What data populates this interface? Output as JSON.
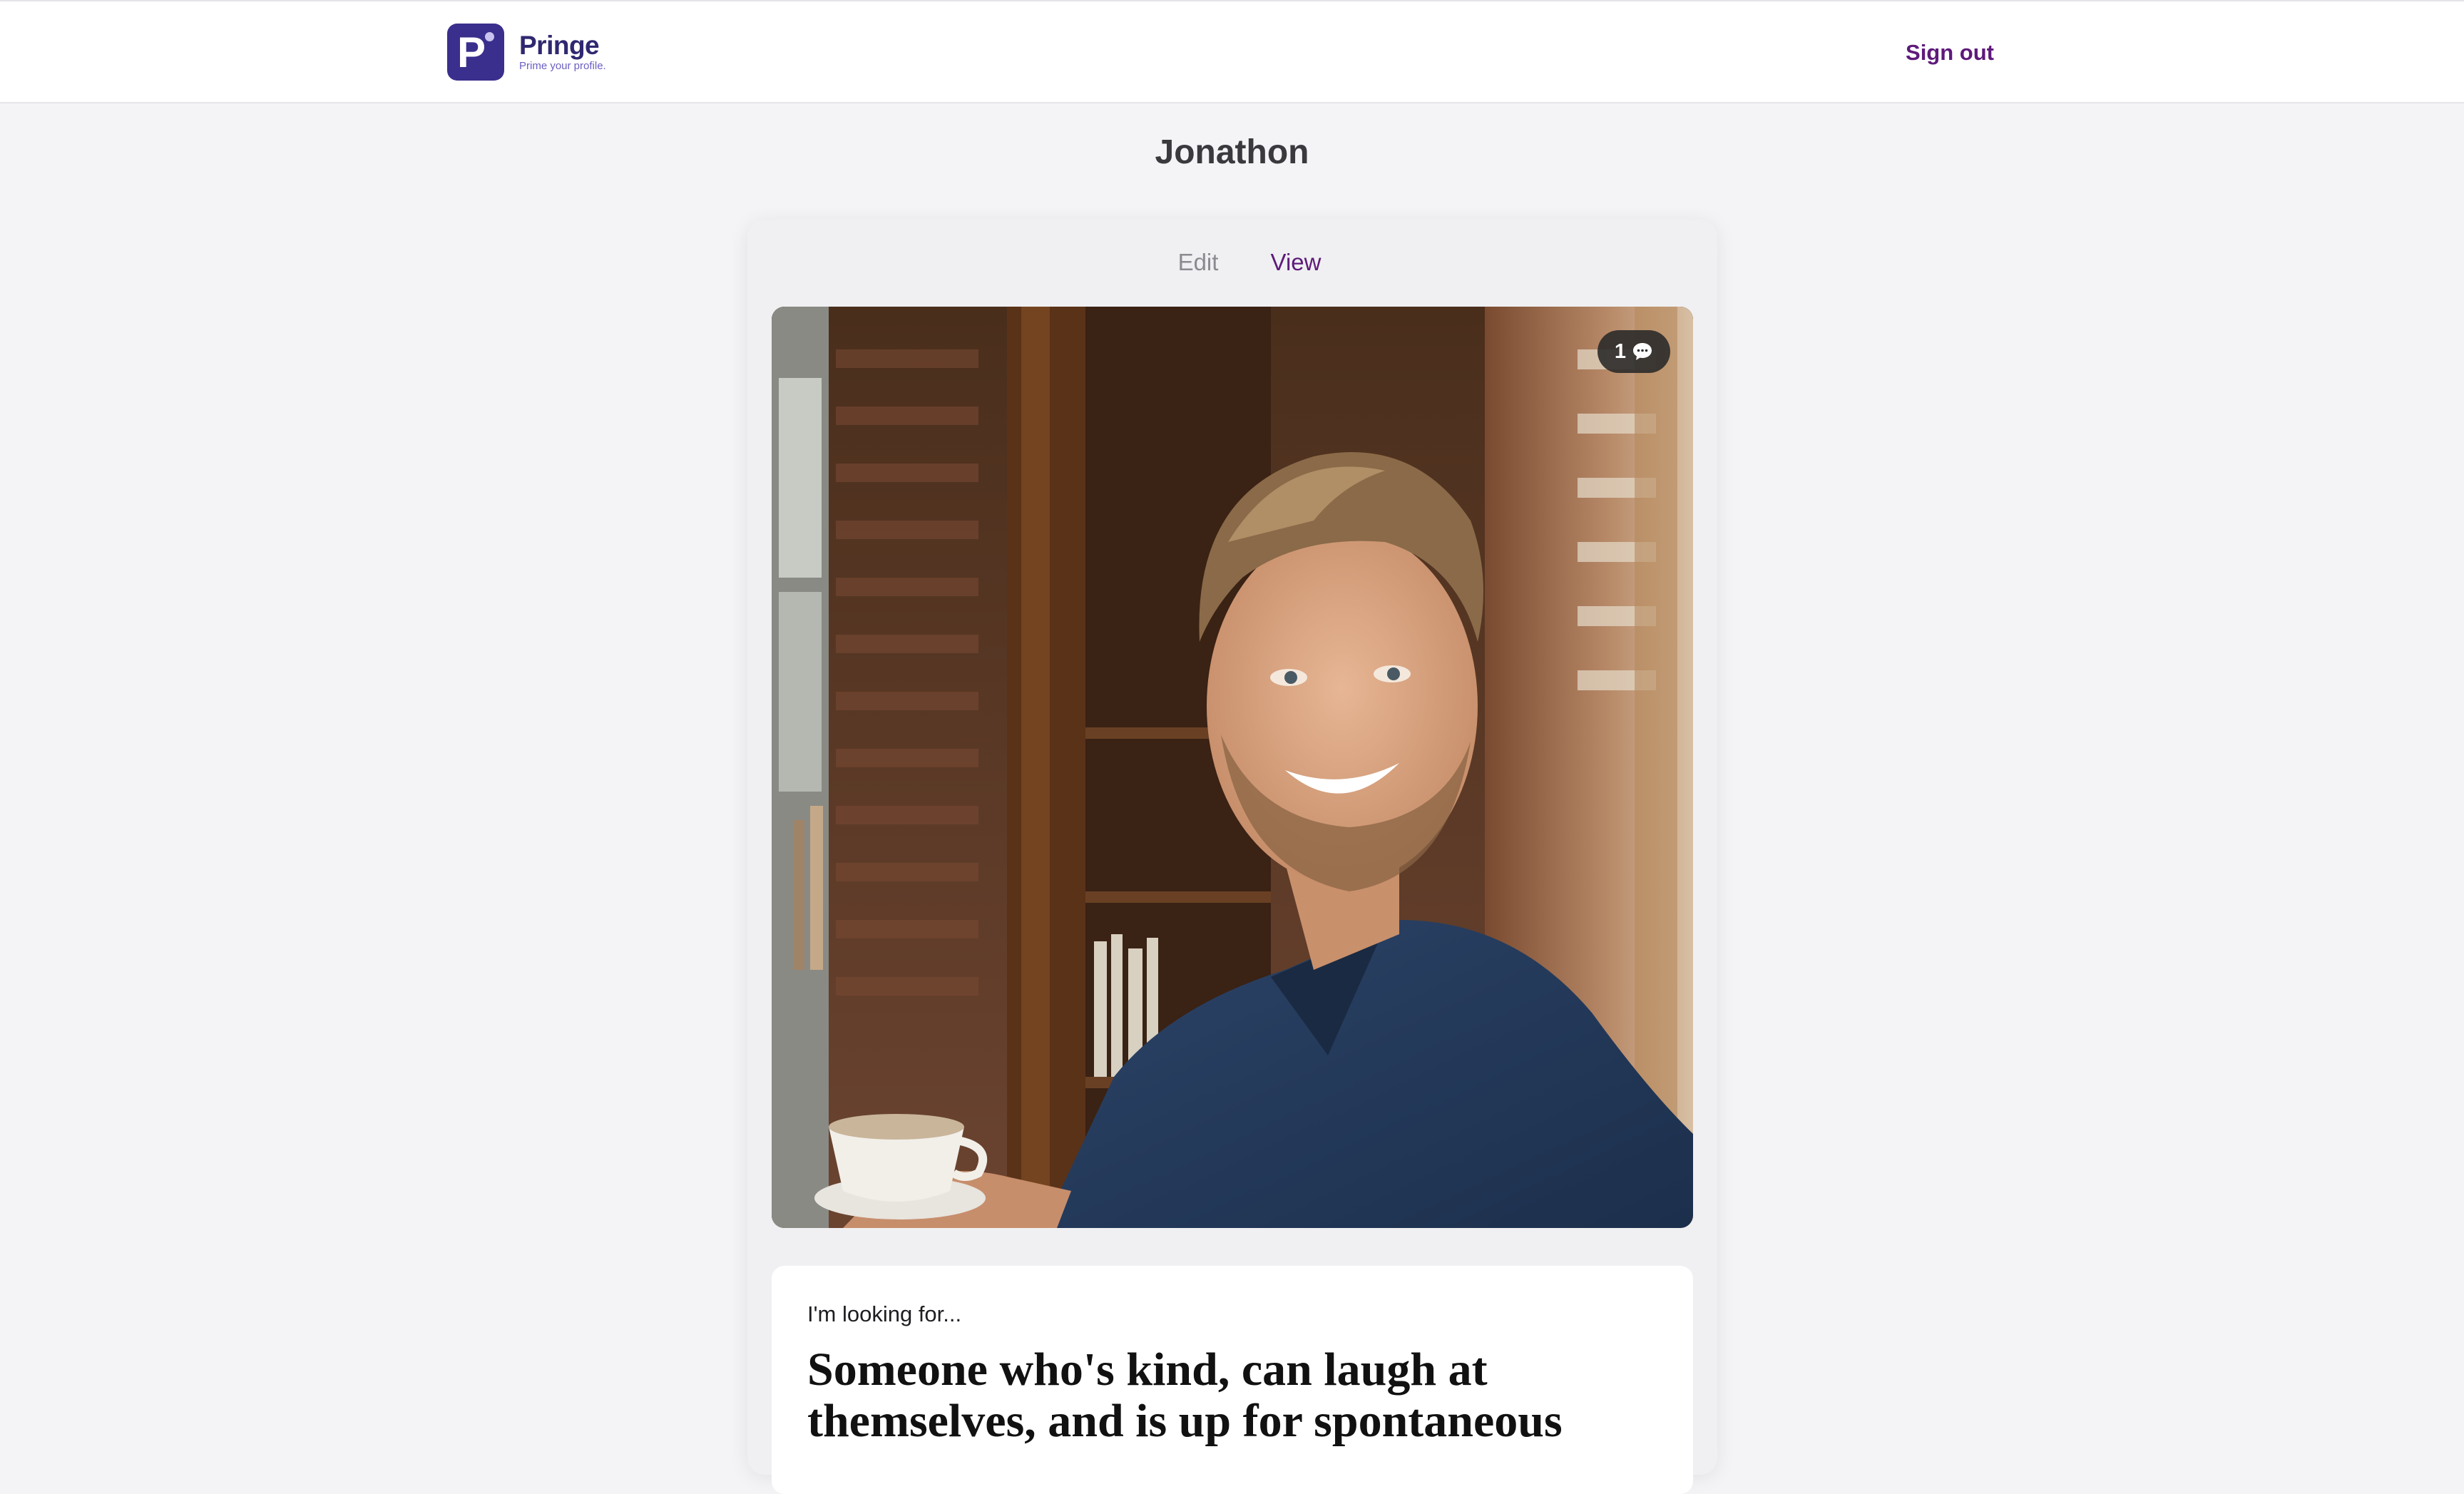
{
  "header": {
    "brand_name": "Pringe",
    "brand_tagline": "Prime your profile.",
    "logo_letter": "P",
    "signout_label": "Sign out"
  },
  "page": {
    "title": "Jonathon"
  },
  "tabs": [
    {
      "label": "Edit",
      "active": false
    },
    {
      "label": "View",
      "active": true
    }
  ],
  "photo": {
    "description_icon": "profile-photo",
    "comment_count": "1",
    "comment_icon": "speech-bubble-icon"
  },
  "prompt": {
    "label": "I'm looking for...",
    "answer": "Someone who's kind, can laugh at themselves, and is up for spontaneous"
  },
  "colors": {
    "brand": "#3a2f8c",
    "accent": "#5e1a7a",
    "page_bg": "#f4f4f6"
  }
}
